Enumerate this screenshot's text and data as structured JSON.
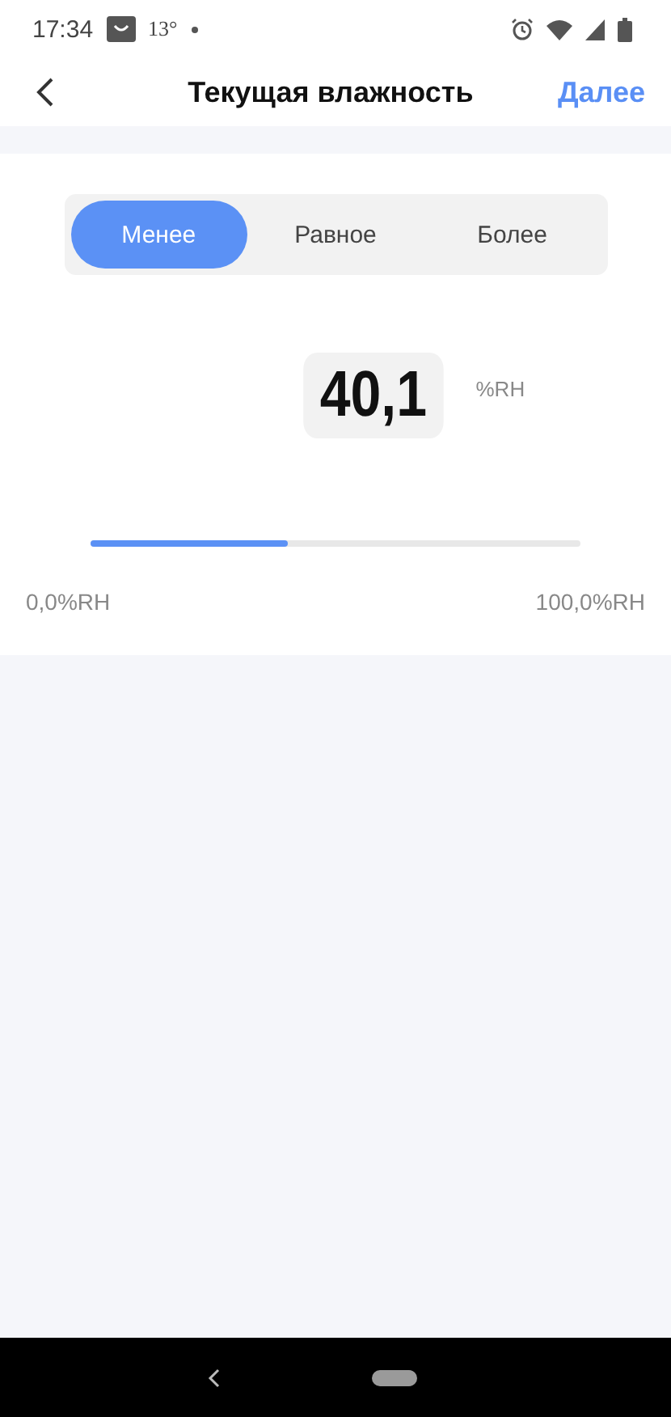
{
  "status_bar": {
    "time": "17:34",
    "temperature": "13°"
  },
  "header": {
    "title": "Текущая влажность",
    "action": "Далее"
  },
  "modes": [
    {
      "label": "Менее",
      "selected": true
    },
    {
      "label": "Равное",
      "selected": false
    },
    {
      "label": "Более",
      "selected": false
    }
  ],
  "value": {
    "reading": "40,1",
    "unit": "%RH"
  },
  "slider": {
    "level": 0.401,
    "min_label": "0,0%RH",
    "max_label": "100,0%RH"
  }
}
